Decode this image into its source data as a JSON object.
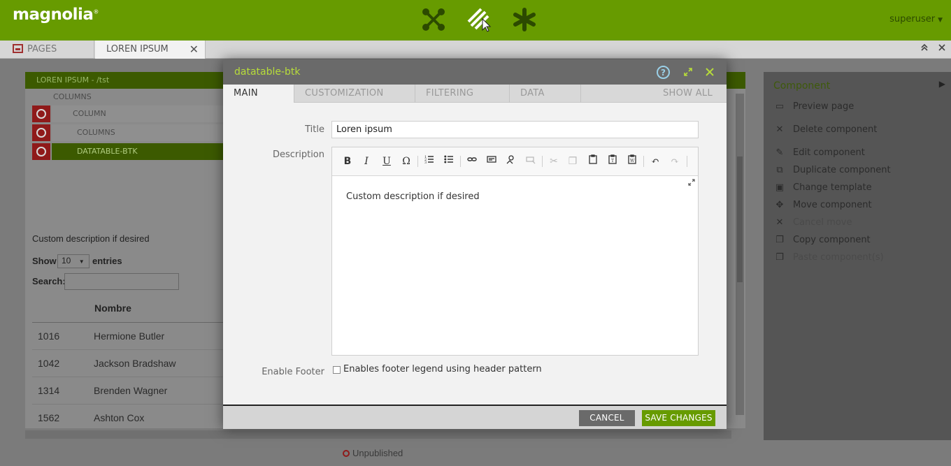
{
  "app": {
    "logo_text": "magnolia",
    "logo_mark": "®",
    "user": "superuser"
  },
  "top_icons": [
    "apps-launcher-icon",
    "pulse-tasks-icon",
    "favorites-icon"
  ],
  "tabs": {
    "pages_label": "PAGES",
    "current_label": "LOREN IPSUM"
  },
  "preview": {
    "path": "LOREN IPSUM - /tst",
    "tree": [
      "COLUMNS",
      "COLUMN",
      "COLUMNS",
      "DATATABLE-BTK"
    ],
    "description": "Custom description if desired",
    "show_label": "Show",
    "entries_value": "10",
    "entries_label": "entries",
    "search_label": "Search:",
    "column_header": "Nombre",
    "rows": [
      {
        "id": "1016",
        "name": "Hermione Butler"
      },
      {
        "id": "1042",
        "name": "Jackson Bradshaw"
      },
      {
        "id": "1314",
        "name": "Brenden Wagner"
      },
      {
        "id": "1562",
        "name": "Ashton Cox"
      }
    ],
    "status": "Unpublished"
  },
  "action_panel": {
    "title": "Component",
    "items": [
      {
        "label": "Preview page",
        "icon": "preview-icon"
      },
      {
        "label": "Delete component",
        "icon": "delete-icon"
      },
      {
        "label": "Edit component",
        "icon": "edit-icon"
      },
      {
        "label": "Duplicate component",
        "icon": "duplicate-icon"
      },
      {
        "label": "Change template",
        "icon": "template-icon"
      },
      {
        "label": "Move component",
        "icon": "move-icon"
      },
      {
        "label": "Cancel move",
        "icon": "cancel-icon"
      },
      {
        "label": "Copy component",
        "icon": "copy-icon"
      },
      {
        "label": "Paste component(s)",
        "icon": "paste-icon"
      }
    ]
  },
  "dialog": {
    "title": "datatable-btk",
    "help": "?",
    "tabs": [
      "MAIN",
      "CUSTOMIZATION",
      "FILTERING",
      "DATA",
      "SHOW ALL"
    ],
    "title_label": "Title",
    "title_value": "Loren ipsum",
    "description_label": "Description",
    "description_value": "Custom description if desired",
    "footer_label": "Enable Footer",
    "footer_checkbox_label": "Enables footer legend using header pattern",
    "cancel_label": "CANCEL",
    "save_label": "SAVE CHANGES"
  },
  "colors": {
    "brand_green": "#679b00",
    "dialog_title": "#b7dc3a",
    "help_blue": "#9ad0e8"
  }
}
